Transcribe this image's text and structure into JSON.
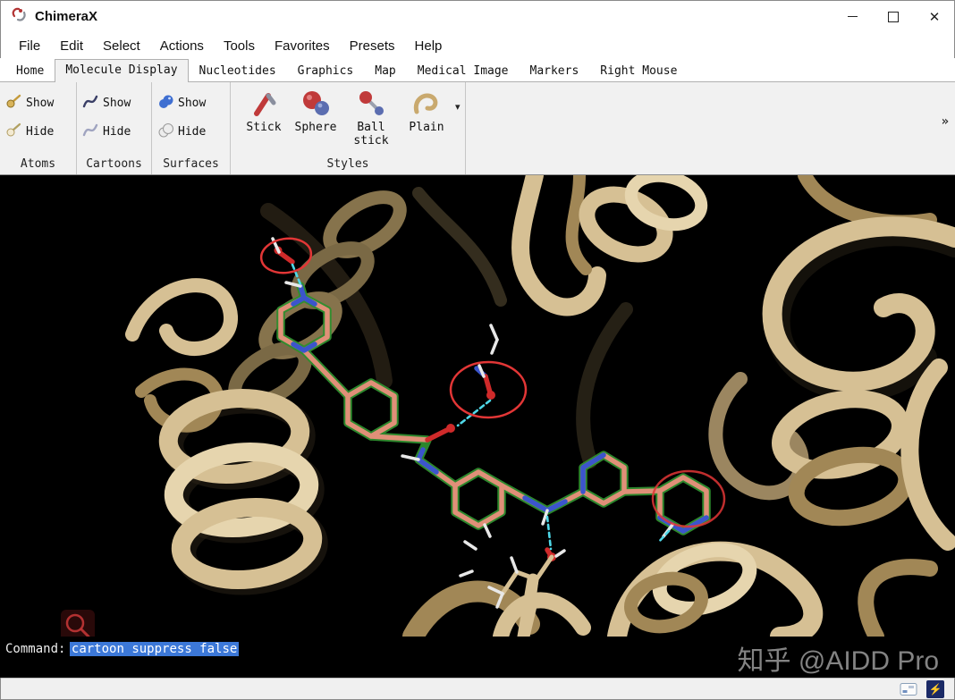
{
  "window": {
    "title": "ChimeraX"
  },
  "icons": {
    "minimize": "–",
    "close": "✕",
    "dropdown_arrow": "▾",
    "overflow": "»",
    "lightning": "⚡"
  },
  "menu": {
    "items": [
      "File",
      "Edit",
      "Select",
      "Actions",
      "Tools",
      "Favorites",
      "Presets",
      "Help"
    ]
  },
  "tabs": {
    "items": [
      "Home",
      "Molecule Display",
      "Nucleotides",
      "Graphics",
      "Map",
      "Medical Image",
      "Markers",
      "Right Mouse"
    ],
    "active": "Molecule Display"
  },
  "toolbar": {
    "atoms": {
      "label": "Atoms",
      "show": "Show",
      "hide": "Hide"
    },
    "cartoons": {
      "label": "Cartoons",
      "show": "Show",
      "hide": "Hide"
    },
    "surfaces": {
      "label": "Surfaces",
      "show": "Show",
      "hide": "Hide"
    },
    "styles": {
      "label": "Styles",
      "stick": "Stick",
      "sphere": "Sphere",
      "ball_line1": "Ball",
      "ball_line2": "stick",
      "plain": "Plain"
    }
  },
  "command": {
    "label": "Command:",
    "value": "cartoon suppress false"
  },
  "watermark": {
    "text": "知乎 @AIDD Pro"
  },
  "colors": {
    "selection_blue": "#3c78d8",
    "ribbon_tan": "#d6c094",
    "ligand_salmon": "#e09078",
    "ligand_outline_green": "#2f8f2f",
    "nitrogen_blue": "#3b55cc",
    "oxygen_red": "#cf2a2a",
    "hbond_cyan": "#4fd8e8",
    "annotation_red": "#e23636"
  }
}
